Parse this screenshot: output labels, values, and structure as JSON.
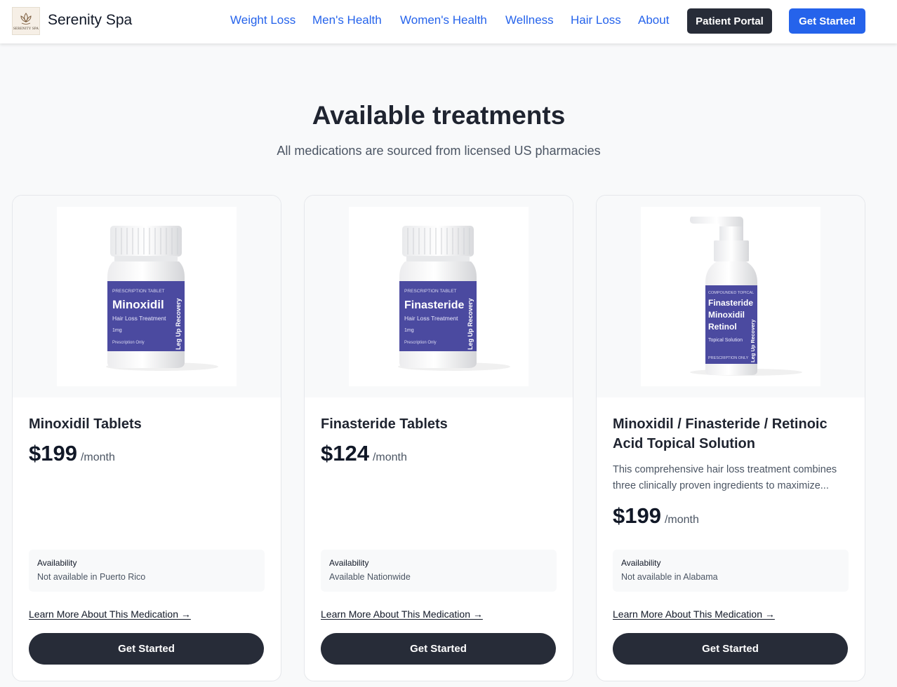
{
  "header": {
    "brand": "Serenity Spa",
    "logo_text": "SERENITY SPA",
    "nav": [
      "Weight Loss",
      "Men's Health",
      "Women's Health",
      "Wellness",
      "Hair Loss",
      "About"
    ],
    "portal_label": "Patient Portal",
    "get_started_label": "Get Started"
  },
  "section": {
    "title": "Available treatments",
    "subtitle": "All medications are sourced from licensed US pharmacies"
  },
  "products": [
    {
      "name": "Minoxidil Tablets",
      "description": "",
      "price": "$199",
      "per": "/month",
      "availability_label": "Availability",
      "availability": "Not available in Puerto Rico",
      "learn_more": "Learn More About This Medication →",
      "cta": "Get Started",
      "label": {
        "top": "PRESCRIPTION TABLET",
        "name": "Minoxidil",
        "sub": "Hair Loss Treatment",
        "dose": "1mg",
        "note": "Prescription Only",
        "brand": "Leg Up Recovery"
      }
    },
    {
      "name": "Finasteride Tablets",
      "description": "",
      "price": "$124",
      "per": "/month",
      "availability_label": "Availability",
      "availability": "Available Nationwide",
      "learn_more": "Learn More About This Medication →",
      "cta": "Get Started",
      "label": {
        "top": "PRESCRIPTION TABLET",
        "name": "Finasteride",
        "sub": "Hair Loss Treatment",
        "dose": "1mg",
        "note": "Prescription Only",
        "brand": "Leg Up Recovery"
      }
    },
    {
      "name": "Minoxidil / Finasteride / Retinoic Acid Topical Solution",
      "description": "This comprehensive hair loss treatment combines three clinically proven ingredients to maximize...",
      "price": "$199",
      "per": "/month",
      "availability_label": "Availability",
      "availability": "Not available in Alabama",
      "learn_more": "Learn More About This Medication →",
      "cta": "Get Started",
      "label": {
        "top": "COMPOUNDED TOPICAL",
        "name1": "Finasteride",
        "name2": "Minoxidil",
        "name3": "Retinol",
        "sub": "Topical Solution",
        "note": "PRESCRIPTION ONLY",
        "brand": "Leg Up Recovery"
      }
    }
  ],
  "colors": {
    "accent": "#2563eb",
    "dark_button": "#272c38",
    "label_purple": "#4b4aa0"
  }
}
